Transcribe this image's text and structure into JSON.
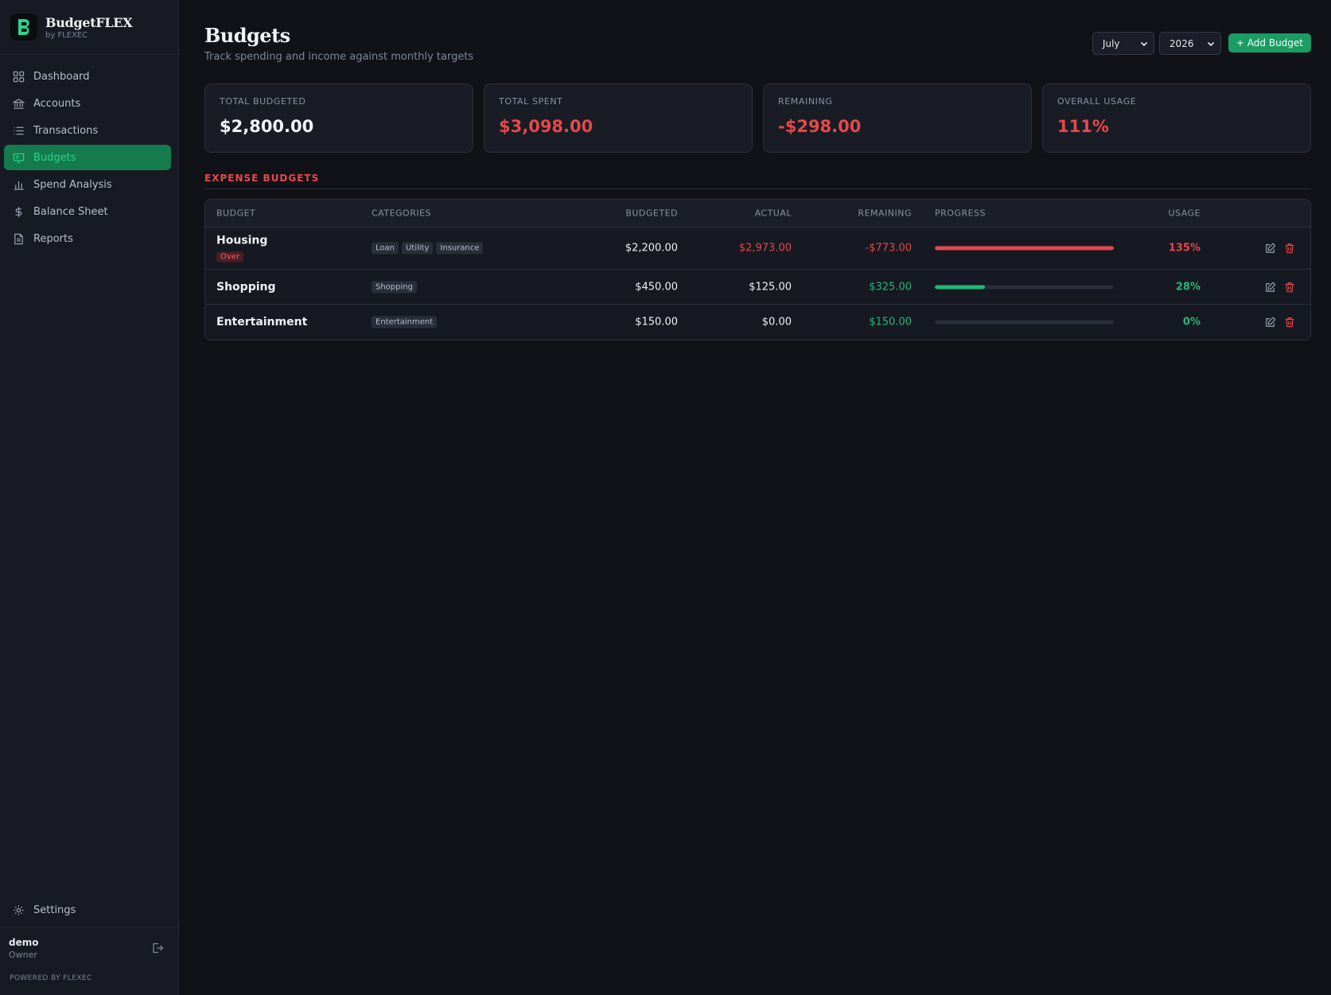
{
  "brand": {
    "name": "BudgetFLEX",
    "sub": "by FLEXEC"
  },
  "nav": [
    {
      "label": "Dashboard",
      "icon": "grid-icon"
    },
    {
      "label": "Accounts",
      "icon": "bank-icon"
    },
    {
      "label": "Transactions",
      "icon": "list-icon"
    },
    {
      "label": "Budgets",
      "icon": "budget-icon",
      "active": true
    },
    {
      "label": "Spend Analysis",
      "icon": "bar-chart-icon"
    },
    {
      "label": "Balance Sheet",
      "icon": "dollar-icon"
    },
    {
      "label": "Reports",
      "icon": "document-icon"
    }
  ],
  "settings_label": "Settings",
  "user": {
    "name": "demo",
    "role": "Owner"
  },
  "powered_by": "POWERED BY FLEXEC",
  "page": {
    "title": "Budgets",
    "subtitle": "Track spending and income against monthly targets"
  },
  "controls": {
    "month": "July",
    "year": "2026",
    "add_label": "+ Add Budget"
  },
  "cards": [
    {
      "label": "TOTAL BUDGETED",
      "value": "$2,800.00",
      "color": "#f3f4f7"
    },
    {
      "label": "TOTAL SPENT",
      "value": "$3,098.00",
      "color": "#e5484d"
    },
    {
      "label": "REMAINING",
      "value": "-$298.00",
      "color": "#e5484d"
    },
    {
      "label": "OVERALL USAGE",
      "value": "111%",
      "color": "#e5484d"
    }
  ],
  "section_title": "EXPENSE BUDGETS",
  "table": {
    "headers": {
      "budget": "BUDGET",
      "categories": "CATEGORIES",
      "budgeted": "BUDGETED",
      "actual": "ACTUAL",
      "remaining": "REMAINING",
      "progress": "PROGRESS",
      "usage": "USAGE"
    },
    "rows": [
      {
        "name": "Housing",
        "badge": "Over",
        "tags": [
          "Loan",
          "Utility",
          "Insurance"
        ],
        "budgeted": "$2,200.00",
        "actual": "$2,973.00",
        "remaining": "-$773.00",
        "progress": 1.0,
        "usage": "135%",
        "status": "over"
      },
      {
        "name": "Shopping",
        "tags": [
          "Shopping"
        ],
        "budgeted": "$450.00",
        "actual": "$125.00",
        "remaining": "$325.00",
        "progress": 0.28,
        "usage": "28%",
        "status": "ok"
      },
      {
        "name": "Entertainment",
        "tags": [
          "Entertainment"
        ],
        "budgeted": "$150.00",
        "actual": "$0.00",
        "remaining": "$150.00",
        "progress": 0.0,
        "usage": "0%",
        "status": "ok"
      }
    ]
  },
  "colors": {
    "accent": "#1a9c62",
    "over": "#e5484d",
    "ok": "#22b87a"
  }
}
